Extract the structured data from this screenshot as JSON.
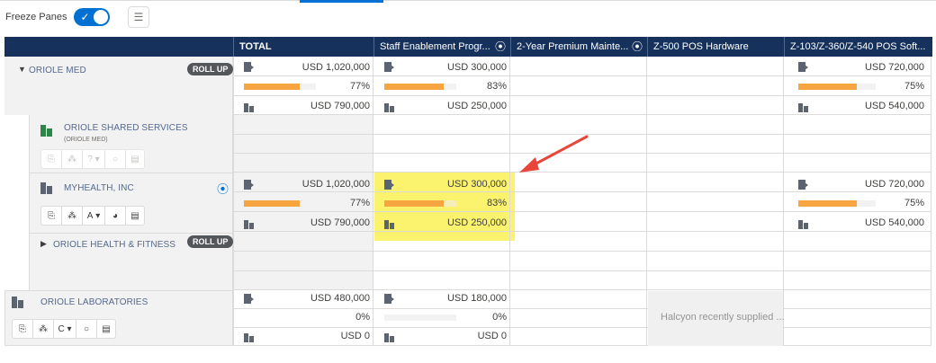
{
  "toolbar": {
    "freeze_label": "Freeze Panes",
    "freeze_on": true,
    "list_icon": "list-icon"
  },
  "columns": [
    {
      "label": "TOTAL"
    },
    {
      "label": "Staff Enablement Progr...",
      "icon": "target-icon"
    },
    {
      "label": "2-Year Premium Mainte...",
      "icon": "target-icon"
    },
    {
      "label": "Z-500 POS Hardware"
    },
    {
      "label": "Z-103/Z-360/Z-540 POS Soft..."
    }
  ],
  "accounts": {
    "oriole_med": {
      "name": "ORIOLE MED",
      "badge": "ROLL UP"
    },
    "shared": {
      "name": "ORIOLE SHARED SERVICES",
      "parent": "(ORIOLE MED)",
      "tier": "?"
    },
    "myhealth": {
      "name": "MYHEALTH, INC",
      "tier": "A"
    },
    "fitness": {
      "name": "ORIOLE HEALTH & FITNESS",
      "badge": "ROLL UP"
    },
    "labs": {
      "name": "ORIOLE LABORATORIES",
      "tier": "C"
    }
  },
  "values": {
    "med_total": "USD 1,020,000",
    "med_total_pct": "77%",
    "med_total_won": "USD 790,000",
    "med_staff": "USD 300,000",
    "med_staff_pct": "83%",
    "med_staff_won": "USD 250,000",
    "med_soft": "USD 720,000",
    "med_soft_pct": "75%",
    "med_soft_won": "USD 540,000",
    "mh_total": "USD 1,020,000",
    "mh_total_pct": "77%",
    "mh_total_won": "USD 790,000",
    "mh_staff": "USD 300,000",
    "mh_staff_pct": "83%",
    "mh_staff_won": "USD 250,000",
    "mh_soft": "USD 720,000",
    "mh_soft_pct": "75%",
    "mh_soft_won": "USD 540,000",
    "lab_total": "USD 480,000",
    "lab_total_pct": "0%",
    "lab_total_won": "USD 0",
    "lab_staff": "USD 180,000",
    "lab_staff_pct": "0%",
    "lab_staff_won": "USD 0",
    "lab_note": "Halcyon recently supplied ..."
  },
  "progress": {
    "p77": 0.77,
    "p83": 0.83,
    "p75": 0.75,
    "p0": 0
  },
  "colors": {
    "header": "#16325c",
    "accent": "#0070d2",
    "bar": "#f7a541",
    "highlight": "#fbf36e",
    "arrow": "#e8463a",
    "account_name": "#54698d"
  }
}
